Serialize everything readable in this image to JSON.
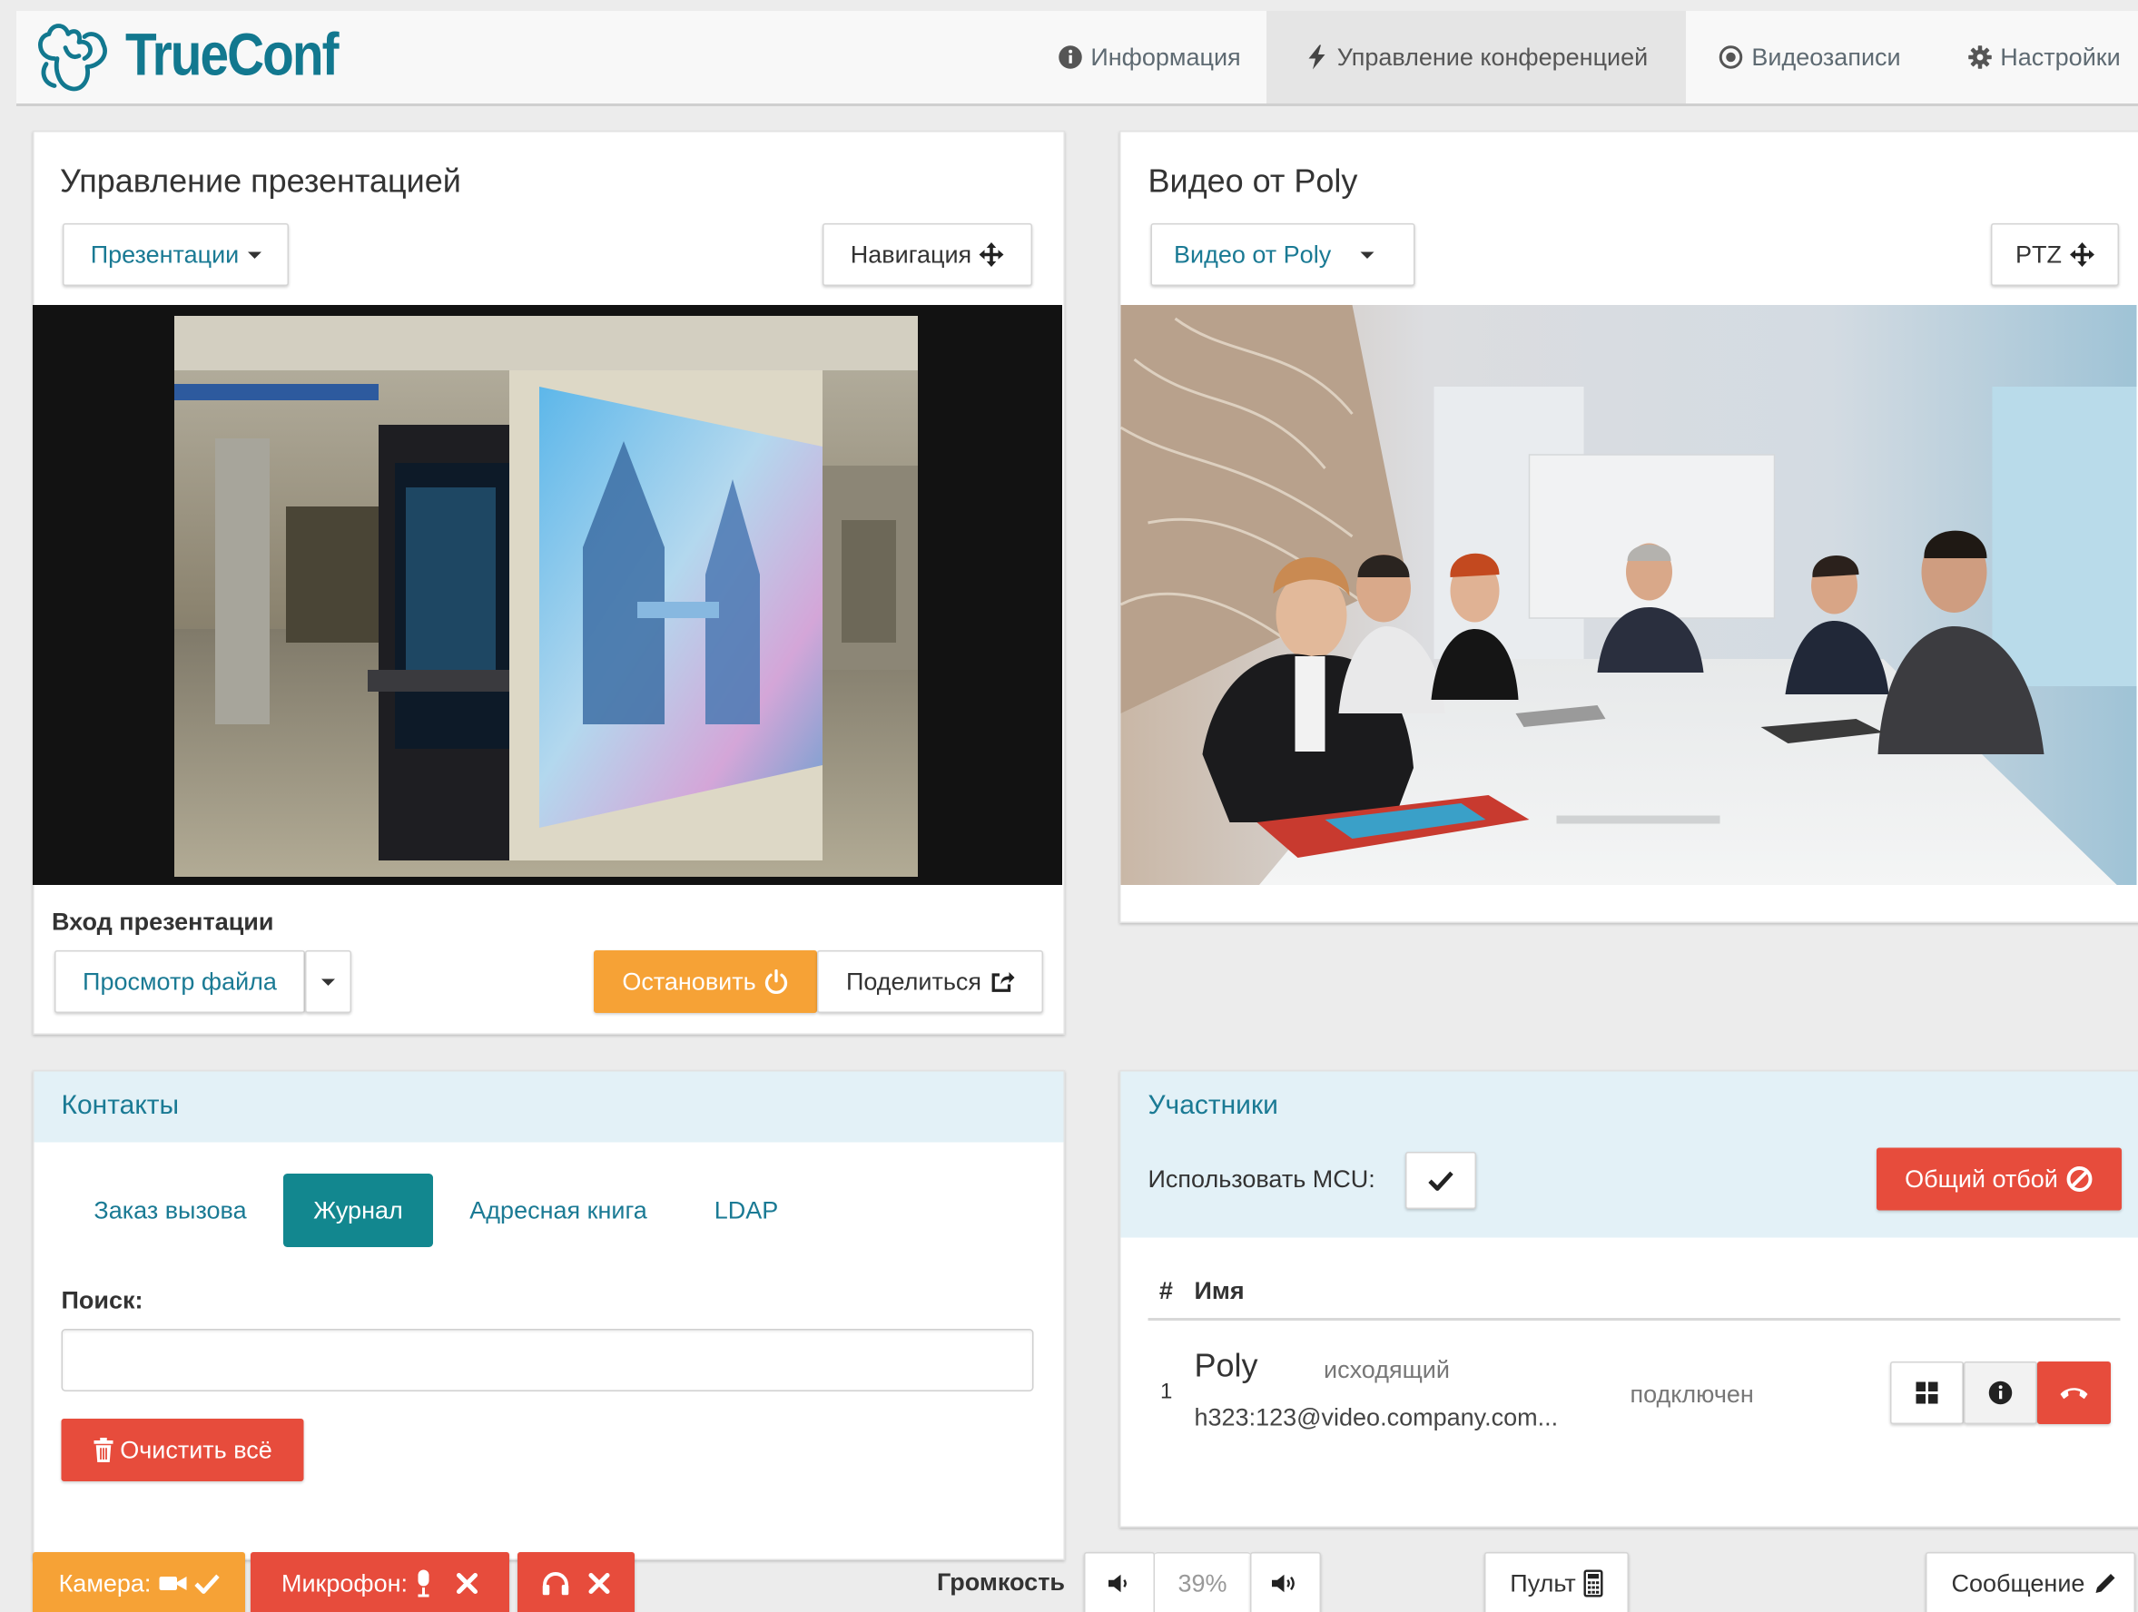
{
  "brand": {
    "name": "TrueConf"
  },
  "nav": {
    "items": [
      {
        "label": "Информация",
        "icon": "info-circle-icon"
      },
      {
        "label": "Управление конференцией",
        "icon": "bolt-icon",
        "active": true
      },
      {
        "label": "Видеозаписи",
        "icon": "record-icon"
      },
      {
        "label": "Настройки",
        "icon": "gear-icon"
      }
    ]
  },
  "presentation": {
    "title": "Управление презентацией",
    "dropdown_label": "Презентации",
    "navigation_label": "Навигация",
    "input_heading": "Вход презентации",
    "file_view_label": "Просмотр файла",
    "stop_label": "Остановить",
    "share_label": "Поделиться"
  },
  "video": {
    "title": "Видео от Poly",
    "source_label": "Видео от Poly",
    "ptz_label": "PTZ"
  },
  "contacts": {
    "title": "Контакты",
    "tabs": [
      "Заказ вызова",
      "Журнал",
      "Адресная книга",
      "LDAP"
    ],
    "active_tab": "Журнал",
    "search_label": "Поиск:",
    "search_value": "",
    "clear_label": "Очистить всё"
  },
  "participants": {
    "title": "Участники",
    "mcu_label": "Использовать MCU:",
    "mcu_checked": true,
    "hangup_all_label": "Общий отбой",
    "columns": {
      "num": "#",
      "name": "Имя"
    },
    "rows": [
      {
        "num": "1",
        "name": "Poly",
        "direction": "исходящий",
        "address": "h323:123@video.company.com...",
        "status": "подключен"
      }
    ]
  },
  "bottom_bar": {
    "camera_label": "Камера:",
    "mic_label": "Микрофон:",
    "volume_label": "Громкость",
    "volume_value": "39%",
    "remote_label": "Пульт",
    "message_label": "Сообщение"
  },
  "colors": {
    "accent": "#12878f",
    "link": "#1a7a94",
    "orange": "#f6a236",
    "red": "#e74c3c",
    "section_head": "#e3f1f7"
  }
}
